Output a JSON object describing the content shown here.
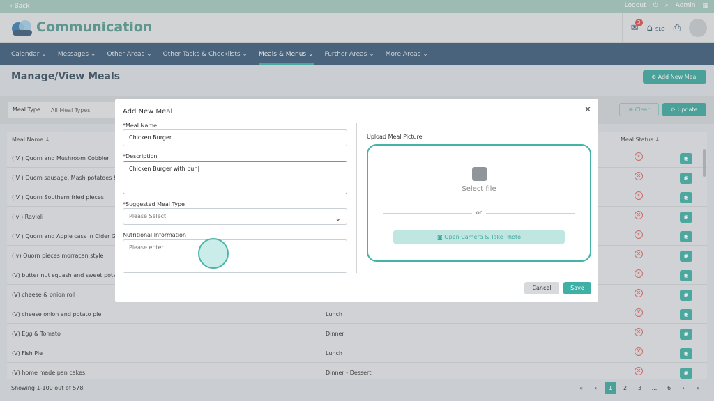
{
  "topbar": {
    "back": "‹ Back",
    "logout": "Logout",
    "admin": "Admin"
  },
  "header": {
    "brand": "Communication",
    "notif_count": "3",
    "home_label": "SLO"
  },
  "nav": [
    "Calendar",
    "Messages",
    "Other Areas",
    "Other Tasks & Checklists",
    "Meals & Menus",
    "Further Areas",
    "More Areas"
  ],
  "page": {
    "title": "Manage/View Meals",
    "add_button": "Add New Meal"
  },
  "filter": {
    "label": "Meal Type",
    "value": "All Meal Types",
    "clear": "Clear",
    "update": "Update"
  },
  "table": {
    "col_name": "Meal Name",
    "col_status": "Meal Status",
    "rows": [
      {
        "name": "( V ) Quorn and Mushroom Cobbler",
        "type": ""
      },
      {
        "name": "( V ) Quorn sausage, Mash potatoes &",
        "type": ""
      },
      {
        "name": "( V ) Quorn Southern fried pieces",
        "type": ""
      },
      {
        "name": "( v ) Ravioli",
        "type": ""
      },
      {
        "name": "( V ) Quorn and Apple cass in Cider Gr",
        "type": ""
      },
      {
        "name": "( v) Quorn pieces morracan style",
        "type": ""
      },
      {
        "name": "(V) butter nut squash and sweet pota",
        "type": ""
      },
      {
        "name": "(V) cheese & onion roll",
        "type": ""
      },
      {
        "name": "(V) cheese onion and potato pie",
        "type": "Lunch"
      },
      {
        "name": "(V) Egg & Tomato",
        "type": "Dinner"
      },
      {
        "name": "(V) Fish Pie",
        "type": "Lunch"
      },
      {
        "name": "(V) home made pan cakes.",
        "type": "Dinner - Dessert"
      }
    ]
  },
  "footer": {
    "showing": "Showing 1-100 out of 578",
    "pages": [
      "1",
      "2",
      "3",
      "...",
      "6"
    ]
  },
  "modal": {
    "title": "Add New Meal",
    "meal_name_label": "*Meal Name",
    "meal_name_value": "Chicken Burger",
    "description_label": "*Description",
    "description_value": "Chicken Burger with bun",
    "meal_type_label": "*Suggested Meal Type",
    "meal_type_placeholder": "Please Select",
    "nutrition_label": "Nutritional Information",
    "nutrition_placeholder": "Please enter",
    "upload_label": "Upload Meal Picture",
    "select_file": "Select file",
    "or": "or",
    "camera_button": "Open Camera & Take Photo",
    "cancel": "Cancel",
    "save": "Save"
  }
}
